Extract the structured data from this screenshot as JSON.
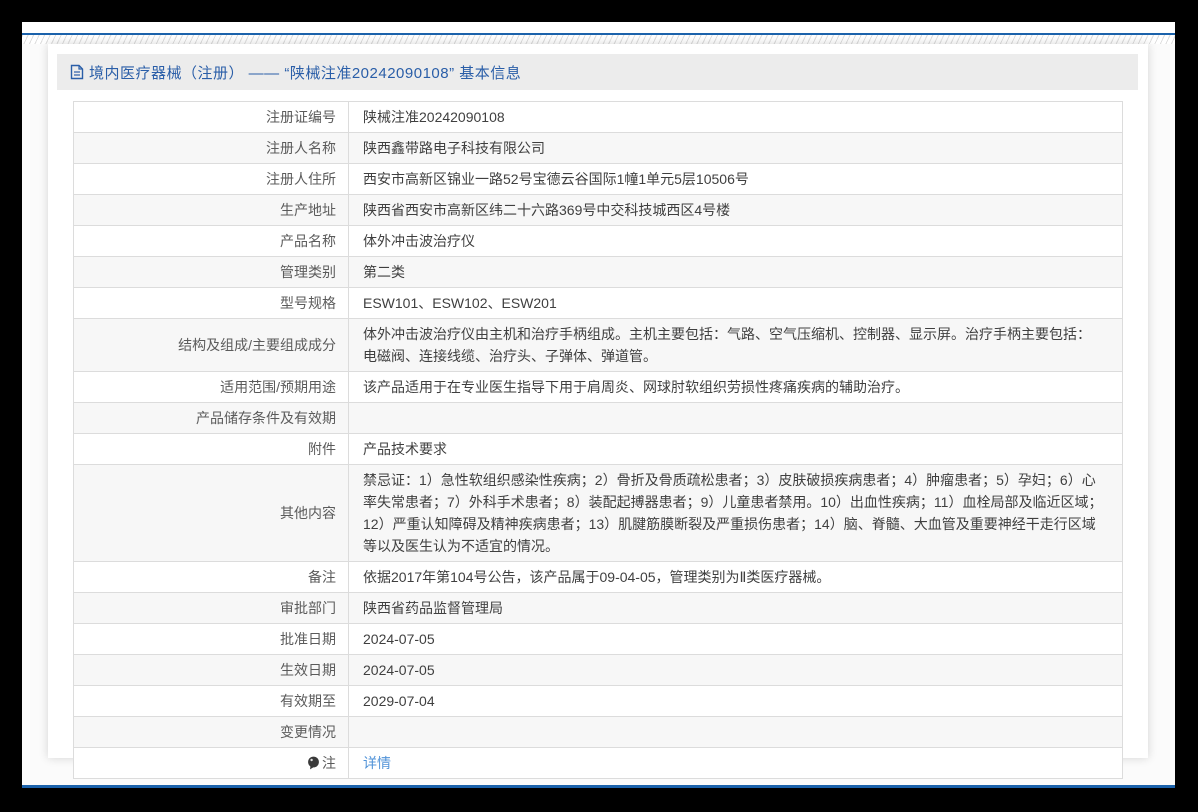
{
  "header": {
    "title_icon": "document-icon",
    "title": "境内医疗器械（注册） —— “陕械注准20242090108” 基本信息"
  },
  "colors": {
    "frame": "#000000",
    "rule_blue": "#1b62ab",
    "title_blue": "#2a5ea8",
    "link_blue": "#5193d8",
    "title_bar_bg": "#ececec",
    "row_alt_bg": "#f7f7f7",
    "table_border": "#dcdcdc"
  },
  "table": {
    "rows": [
      {
        "label": "注册证编号",
        "value": "陕械注准20242090108"
      },
      {
        "label": "注册人名称",
        "value": "陕西鑫带路电子科技有限公司"
      },
      {
        "label": "注册人住所",
        "value": "西安市高新区锦业一路52号宝德云谷国际1幢1单元5层10506号"
      },
      {
        "label": "生产地址",
        "value": "陕西省西安市高新区纬二十六路369号中交科技城西区4号楼"
      },
      {
        "label": "产品名称",
        "value": "体外冲击波治疗仪"
      },
      {
        "label": "管理类别",
        "value": "第二类"
      },
      {
        "label": "型号规格",
        "value": "ESW101、ESW102、ESW201"
      },
      {
        "label": "结构及组成/主要组成成分",
        "value": "体外冲击波治疗仪由主机和治疗手柄组成。主机主要包括：气路、空气压缩机、控制器、显示屏。治疗手柄主要包括：电磁阀、连接线缆、治疗头、子弹体、弹道管。"
      },
      {
        "label": "适用范围/预期用途",
        "value": "该产品适用于在专业医生指导下用于肩周炎、网球肘软组织劳损性疼痛疾病的辅助治疗。"
      },
      {
        "label": "产品储存条件及有效期",
        "value": ""
      },
      {
        "label": "附件",
        "value": "产品技术要求"
      },
      {
        "label": "其他内容",
        "value": "禁忌证：1）急性软组织感染性疾病；2）骨折及骨质疏松患者；3）皮肤破损疾病患者；4）肿瘤患者；5）孕妇；6）心率失常患者；7）外科手术患者；8）装配起搏器患者；9）儿童患者禁用。10）出血性疾病；11）血栓局部及临近区域；12）严重认知障碍及精神疾病患者；13）肌腱筋膜断裂及严重损伤患者；14）脑、脊髓、大血管及重要神经干走行区域等以及医生认为不适宜的情况。"
      },
      {
        "label": "备注",
        "value": "依据2017年第104号公告，该产品属于09-04-05，管理类别为Ⅱ类医疗器械。"
      },
      {
        "label": "审批部门",
        "value": "陕西省药品监督管理局"
      },
      {
        "label": "批准日期",
        "value": "2024-07-05"
      },
      {
        "label": "生效日期",
        "value": "2024-07-05"
      },
      {
        "label": "有效期至",
        "value": "2029-07-04"
      },
      {
        "label": "变更情况",
        "value": ""
      },
      {
        "label": "注",
        "value": "详情",
        "label_icon": "note-balloon-icon",
        "value_is_link": true
      }
    ]
  }
}
